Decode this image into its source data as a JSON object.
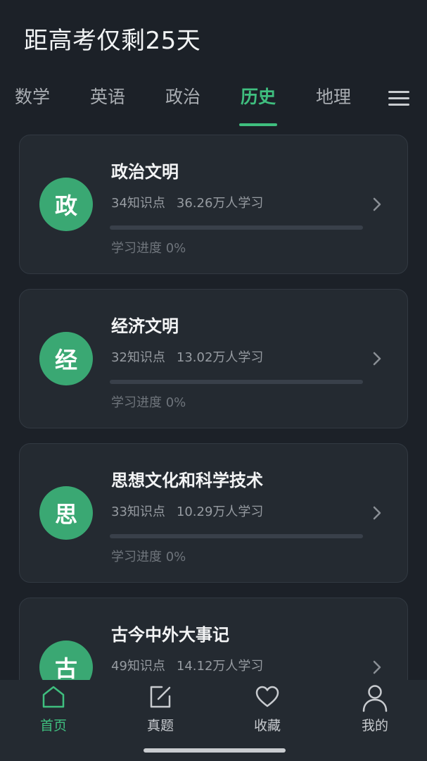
{
  "header": {
    "title": "距高考仅剩25天"
  },
  "tabs": [
    {
      "label": "数学",
      "active": false
    },
    {
      "label": "英语",
      "active": false
    },
    {
      "label": "政治",
      "active": false
    },
    {
      "label": "历史",
      "active": true
    },
    {
      "label": "地理",
      "active": false
    }
  ],
  "cards": [
    {
      "badge": "政",
      "title": "政治文明",
      "points": "34知识点",
      "learners": "36.26万人学习",
      "progress_text": "学习进度 0%",
      "progress": 0
    },
    {
      "badge": "经",
      "title": "经济文明",
      "points": "32知识点",
      "learners": "13.02万人学习",
      "progress_text": "学习进度 0%",
      "progress": 0
    },
    {
      "badge": "思",
      "title": "思想文化和科学技术",
      "points": "33知识点",
      "learners": "10.29万人学习",
      "progress_text": "学习进度 0%",
      "progress": 0
    },
    {
      "badge": "古",
      "title": "古今中外大事记",
      "points": "49知识点",
      "learners": "14.12万人学习",
      "progress_text": "",
      "progress": 0
    }
  ],
  "bottom_nav": [
    {
      "label": "首页",
      "icon": "home-icon",
      "active": true
    },
    {
      "label": "真题",
      "icon": "edit-icon",
      "active": false
    },
    {
      "label": "收藏",
      "icon": "heart-icon",
      "active": false
    },
    {
      "label": "我的",
      "icon": "user-icon",
      "active": false
    }
  ],
  "colors": {
    "accent": "#3fbf7f",
    "badge": "#3aa873",
    "background": "#1c2128",
    "card": "#242a31"
  }
}
